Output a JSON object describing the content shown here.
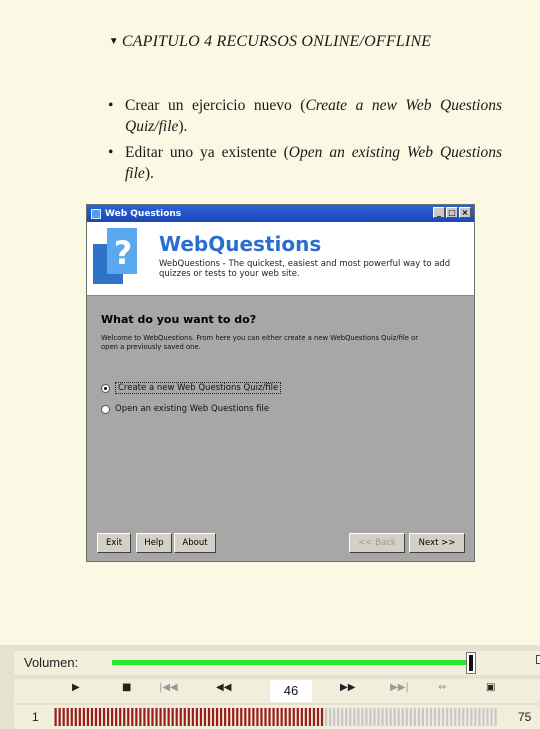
{
  "chapter": {
    "title": "CAPITULO 4 RECURSOS ONLINE/OFFLINE"
  },
  "bullets": [
    {
      "text": "Crear un ejercicio nuevo (",
      "italic": "Create a new Web Questions Quiz/file",
      "end": ")."
    },
    {
      "text": "Editar uno ya existente (",
      "italic": "Open an existing Web Questions file",
      "end": ")."
    }
  ],
  "window": {
    "title": "Web Questions",
    "app_name": "WebQuestions",
    "app_desc": "WebQuestions - The quickest, easiest and most powerful way to add quizzes or tests to your web site.",
    "heading": "What do you want to do?",
    "intro": "Welcome to WebQuestions. From here you can either create a new WebQuestions Quiz/file or open a previously saved one.",
    "options": [
      {
        "label": "Create a new Web Questions Quiz/file",
        "selected": true
      },
      {
        "label": "Open an existing Web Questions file",
        "selected": false
      }
    ],
    "buttons": {
      "exit": "Exit",
      "help": "Help",
      "about": "About",
      "back": "<< Back",
      "next": "Next >>"
    }
  },
  "player": {
    "volume_label": "Volumen:",
    "volume_level": 0.97,
    "current_page": "46",
    "chapter_index": "1",
    "total_pages": "75",
    "progress_fraction": 0.61,
    "colors": {
      "volume": "#29e829",
      "progress": "#9b1c1c",
      "remaining": "#c8c8c8"
    }
  }
}
